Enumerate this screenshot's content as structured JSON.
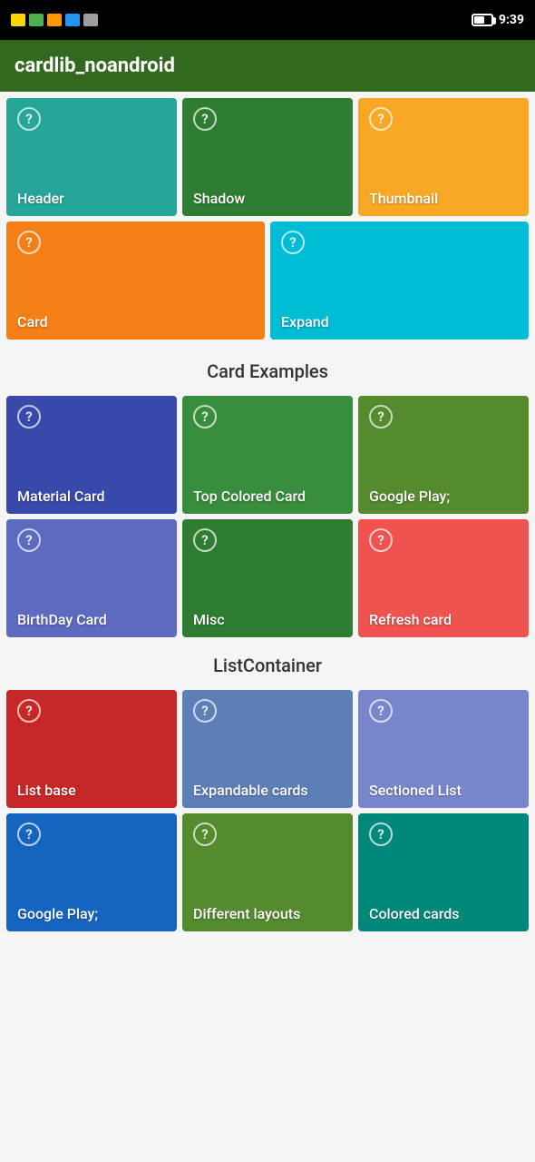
{
  "statusBar": {
    "time": "9:39"
  },
  "appBar": {
    "title": "cardlib_noandroid"
  },
  "sections": {
    "cardExamplesLabel": "Card Examples",
    "listContainerLabel": "ListContainer"
  },
  "topGrid": [
    {
      "id": "header-card",
      "label": "Header",
      "color": "c-teal"
    },
    {
      "id": "shadow-card",
      "label": "Shadow",
      "color": "c-green"
    },
    {
      "id": "thumbnail-card",
      "label": "Thumbnail",
      "color": "c-amber"
    }
  ],
  "midGrid": [
    {
      "id": "card-card",
      "label": "Card",
      "color": "c-orange"
    },
    {
      "id": "expand-card",
      "label": "Expand",
      "color": "c-cyan"
    }
  ],
  "cardExamplesGrid": [
    {
      "id": "material-card",
      "label": "Material Card",
      "color": "c-blue-dark"
    },
    {
      "id": "top-colored-card",
      "label": "Top Colored Card",
      "color": "c-green2"
    },
    {
      "id": "google-play-card",
      "label": "Google Play;",
      "color": "c-lime"
    },
    {
      "id": "birthday-card",
      "label": "BirthDay Card",
      "color": "c-indigo"
    },
    {
      "id": "misc-card",
      "label": "Misc",
      "color": "c-green"
    },
    {
      "id": "refresh-card",
      "label": "Refresh card",
      "color": "c-pink"
    }
  ],
  "listContainerGrid": [
    {
      "id": "list-base-card",
      "label": "List base",
      "color": "c-red"
    },
    {
      "id": "expandable-cards-card",
      "label": "Expandable cards",
      "color": "c-blue-mid"
    },
    {
      "id": "sectioned-list-card",
      "label": "Sectioned List",
      "color": "c-slate"
    },
    {
      "id": "google-play2-card",
      "label": "Google Play;",
      "color": "c-google2"
    },
    {
      "id": "different-layouts-card",
      "label": "Different layouts",
      "color": "c-google"
    },
    {
      "id": "colored-cards-card",
      "label": "Colored cards",
      "color": "c-teal3"
    }
  ]
}
